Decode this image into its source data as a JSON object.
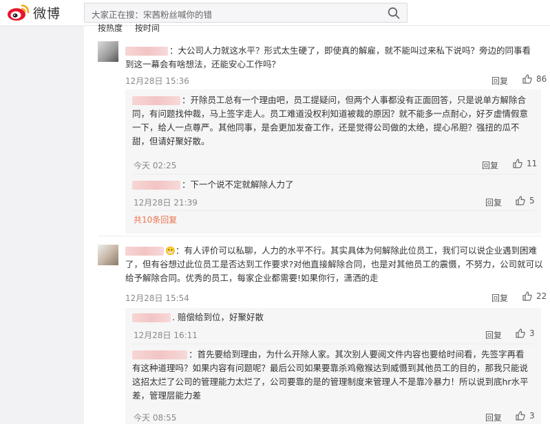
{
  "header": {
    "logo_text": "微博",
    "search_text": "大家正在搜：宋茜粉丝喊你的错"
  },
  "sort": {
    "hot": "按热度",
    "time": "按时间"
  },
  "comments": [
    {
      "text": "：大公司人力就这水平？形式太生硬了，即使真的解雇，就不能叫过来私下说吗？旁边的同事看到这一幕会有啥想法，还能安心工作吗？",
      "time": "12月28日 15:36",
      "reply": "回复",
      "likes": "86",
      "replies": [
        {
          "text": "：开除员工总有一个理由吧，员工提疑问，但两个人事都没有正面回答，只是说单方解除合同，有问题找仲裁，马上签字走人。员工难道没权利知道被裁的原因？就不能多一点耐心，好歹虚情假意一下，给人一点尊严。其他同事，是会更加发奋工作，还是觉得公司做的太绝，提心吊胆？强扭的瓜不甜，但请好聚好散。",
          "time": "今天 02:25",
          "reply": "回复",
          "likes": "11"
        },
        {
          "text": "：下一个说不定就解除人力了",
          "time": "12月28日 21:39",
          "reply": "回复",
          "likes": "5"
        }
      ],
      "more": "共10条回复"
    },
    {
      "text": "：有人评价可以私聊，人力的水平不行。其实具体为何解除此位员工，我们可以说企业遇到困难了，但有谷想过此位员工是否达到工作要求?对他直接解除合同，也是对其他员工的震慑，不努力，公司就可以给予解除合同。优秀的员工，每家企业都需要!如果你行，潇洒的走",
      "time": "12月28日 15:54",
      "reply": "回复",
      "likes": "22",
      "replies": [
        {
          "text": ". 赔偿给到位，好聚好散",
          "time": "12月28日 16:11",
          "reply": "回复",
          "likes": "3"
        },
        {
          "text": "：首先要给到理由，为什么开除人家。其次别人要阅文件内容也要给时间看，先签字再看有这种道理吗？如果内容有问题呢？最后公司如果要靠杀鸡儆猴达到威慑到其他员工的目的，那我只能说这招太烂了公司的管理能力太烂了，公司要靠的是的管理制度来管理人不是靠冷暴力！所以说到底hr水平差，管理层能力差",
          "time": "今天 08:55",
          "reply": "回复",
          "likes": "3"
        }
      ]
    }
  ],
  "colors": {
    "accent": "#eb7350",
    "like": "#555555"
  }
}
